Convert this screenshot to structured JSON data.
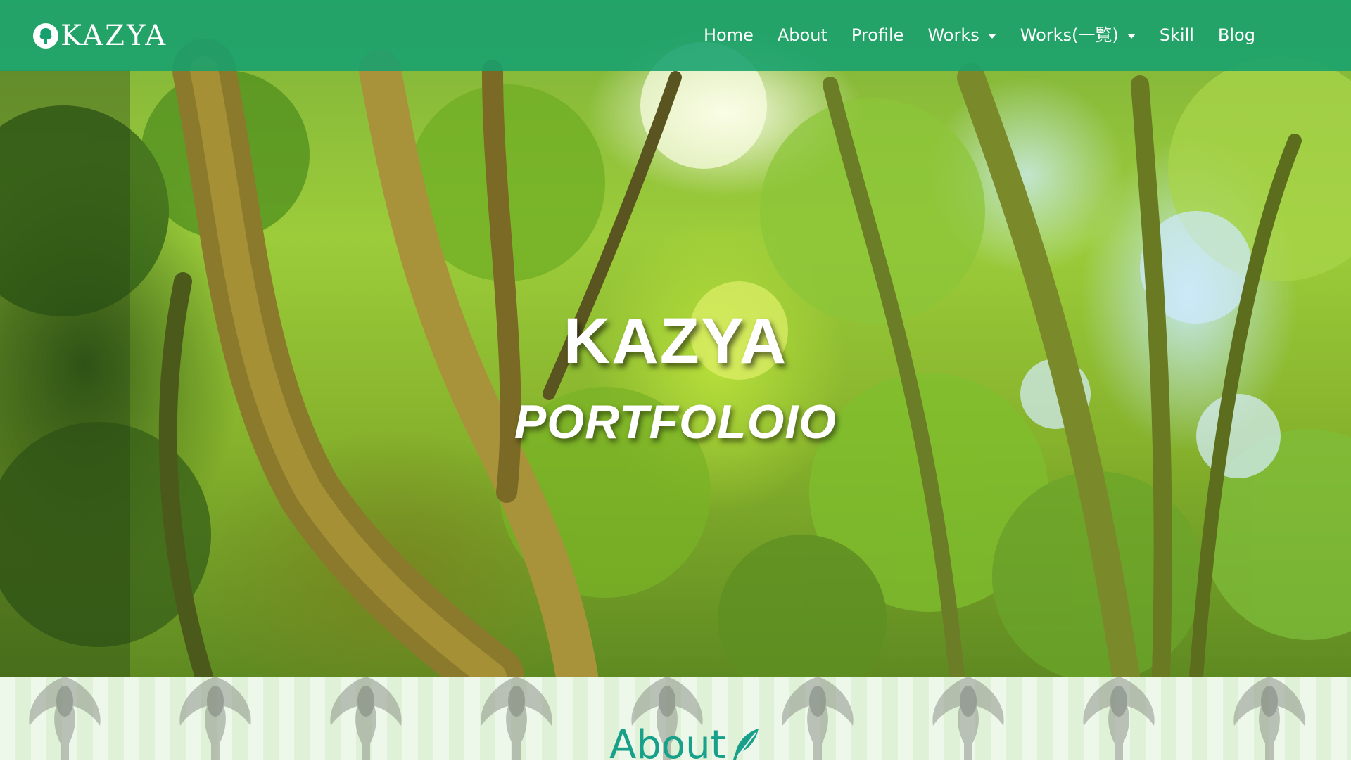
{
  "navbar": {
    "brand": "KAZYA",
    "brand_icon": "tree-icon",
    "background_color": "#16a06e",
    "items": [
      {
        "label": "Home",
        "dropdown": false
      },
      {
        "label": "About",
        "dropdown": false
      },
      {
        "label": "Profile",
        "dropdown": false
      },
      {
        "label": "Works",
        "dropdown": true
      },
      {
        "label": "Works(一覧)",
        "dropdown": true
      },
      {
        "label": "Skill",
        "dropdown": false
      },
      {
        "label": "Blog",
        "dropdown": false
      }
    ]
  },
  "hero": {
    "title": "KAZYA",
    "subtitle": "PORTFOLOIO"
  },
  "about": {
    "heading": "About",
    "heading_icon": "feather-icon",
    "heading_color": "#18a08a"
  }
}
